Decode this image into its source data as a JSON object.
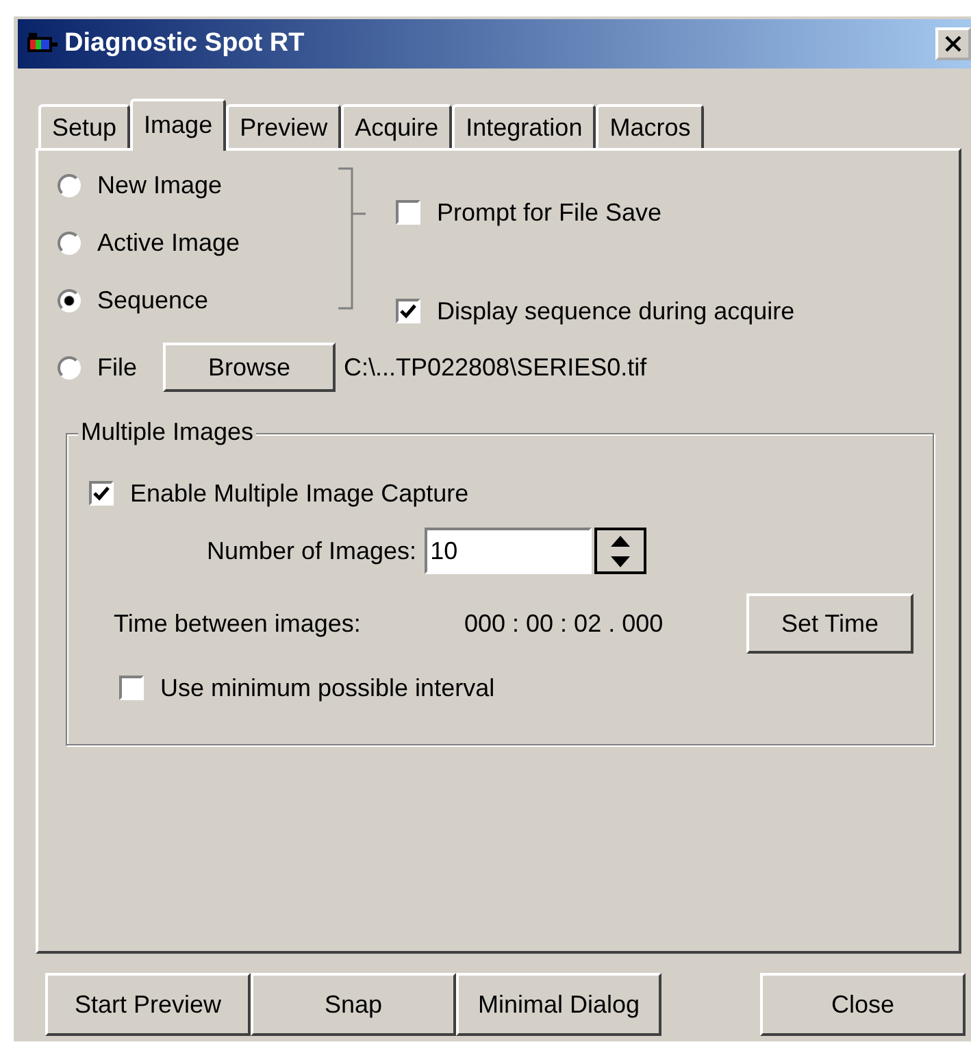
{
  "window": {
    "title": "Diagnostic Spot RT"
  },
  "tabs": [
    {
      "label": "Setup",
      "selected": false
    },
    {
      "label": "Image",
      "selected": true
    },
    {
      "label": "Preview",
      "selected": false
    },
    {
      "label": "Acquire",
      "selected": false
    },
    {
      "label": "Integration",
      "selected": false
    },
    {
      "label": "Macros",
      "selected": false
    }
  ],
  "source_options": [
    {
      "label": "New Image",
      "selected": false
    },
    {
      "label": "Active Image",
      "selected": false
    },
    {
      "label": "Sequence",
      "selected": true
    }
  ],
  "save_options": [
    {
      "label": "Prompt for File Save",
      "checked": false
    },
    {
      "label": "Display sequence during acquire",
      "checked": true
    }
  ],
  "file_option": {
    "label": "File",
    "selected": false,
    "browse_button": "Browse",
    "path": "C:\\...TP022808\\SERIES0.tif"
  },
  "multiple_images": {
    "title": "Multiple Images",
    "enable": {
      "label": "Enable Multiple Image Capture",
      "checked": true
    },
    "number_label": "Number of Images:",
    "number_value": "10",
    "time_label": "Time between images:",
    "time_value": "000 : 00 : 02 . 000",
    "set_time_button": "Set Time",
    "min_interval": {
      "label": "Use minimum possible interval",
      "checked": false
    }
  },
  "footer_buttons": [
    "Start Preview",
    "Snap",
    "Minimal Dialog",
    "Close"
  ]
}
